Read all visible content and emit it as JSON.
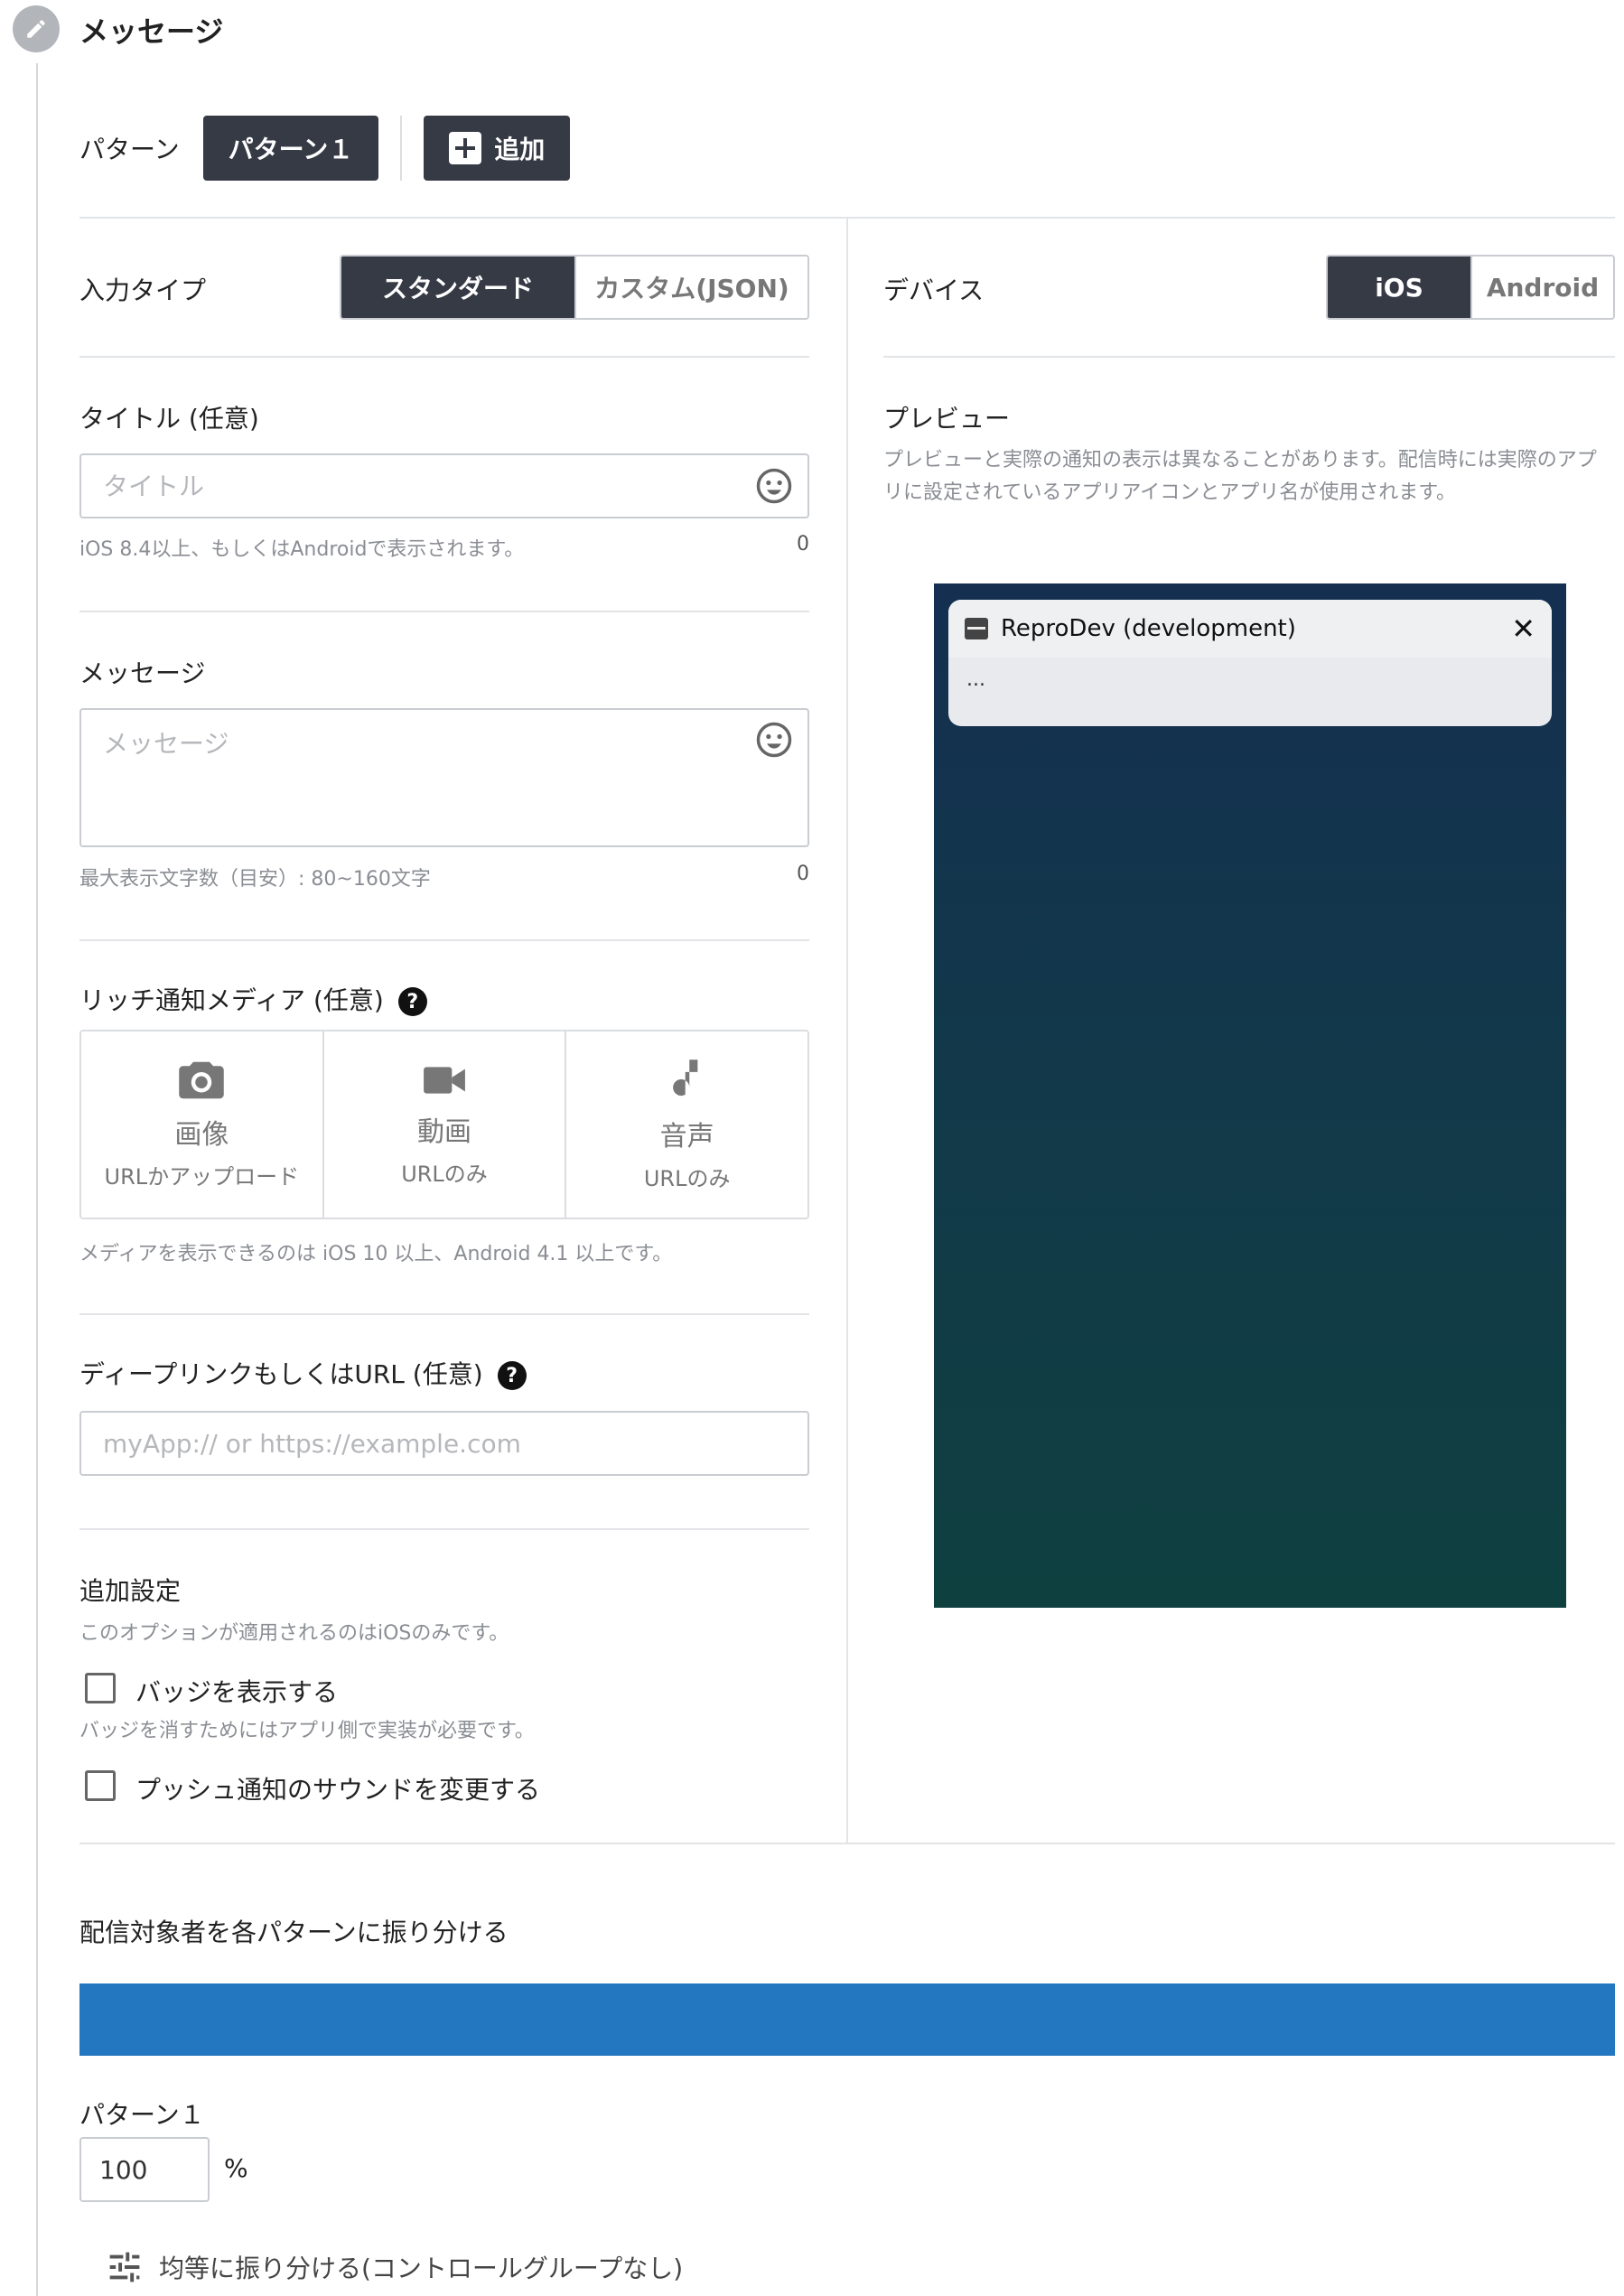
{
  "step": {
    "title": "メッセージ",
    "icon": "pencil-icon"
  },
  "pattern": {
    "label": "パターン",
    "active_pattern": "パターン１",
    "add_label": "追加"
  },
  "input_type": {
    "label": "入力タイプ",
    "options": [
      "スタンダード",
      "カスタム(JSON)"
    ],
    "selected": "スタンダード"
  },
  "device": {
    "label": "デバイス",
    "options": [
      "iOS",
      "Android"
    ],
    "selected": "iOS"
  },
  "title_field": {
    "label": "タイトル (任意)",
    "placeholder": "タイトル",
    "hint": "iOS 8.4以上、もしくはAndroidで表示されます。",
    "count": "0"
  },
  "message_field": {
    "label": "メッセージ",
    "placeholder": "メッセージ",
    "hint": "最大表示文字数（目安）: 80~160文字",
    "count": "0"
  },
  "rich_media": {
    "label": "リッチ通知メディア (任意)",
    "items": [
      {
        "icon": "camera-icon",
        "title": "画像",
        "sub": "URLかアップロード"
      },
      {
        "icon": "video-icon",
        "title": "動画",
        "sub": "URLのみ"
      },
      {
        "icon": "music-note-icon",
        "title": "音声",
        "sub": "URLのみ"
      }
    ],
    "hint": "メディアを表示できるのは iOS 10 以上、Android 4.1 以上です。"
  },
  "deeplink": {
    "label": "ディープリンクもしくはURL (任意)",
    "placeholder": "myApp:// or https://example.com"
  },
  "additional": {
    "label": "追加設定",
    "hint": "このオプションが適用されるのはiOSのみです。",
    "badge_label": "バッジを表示する",
    "badge_hint": "バッジを消すためにはアプリ側で実装が必要です。",
    "sound_label": "プッシュ通知のサウンドを変更する"
  },
  "preview": {
    "label": "プレビュー",
    "note": "プレビューと実際の通知の表示は異なることがあります。配信時には実際のアプリに設定されているアプリアイコンとアプリ名が使用されます。",
    "app_name": "ReproDev (development)",
    "body": "..."
  },
  "distribution": {
    "label": "配信対象者を各パターンに振り分ける",
    "pattern_name": "パターン１",
    "value": "100",
    "unit": "%",
    "share": 1.0,
    "equal_label": "均等に振り分ける(コントロールグループなし)",
    "bar_color": "#2377c0"
  }
}
